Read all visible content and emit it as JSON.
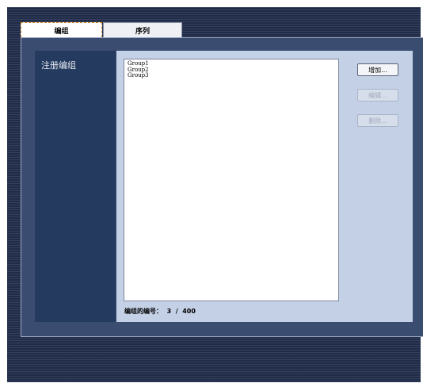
{
  "tabs": [
    {
      "label": "编组",
      "active": true
    },
    {
      "label": "序列",
      "active": false
    }
  ],
  "left_panel": {
    "title": "注册编组"
  },
  "group_list": {
    "items": [
      "Group1",
      "Group2",
      "Group3"
    ]
  },
  "count": {
    "label": "编组的编号：",
    "value": "3  /  400"
  },
  "buttons": {
    "add": {
      "label": "增加...",
      "enabled": true
    },
    "edit": {
      "label": "编辑...",
      "enabled": false
    },
    "delete": {
      "label": "删除...",
      "enabled": false
    }
  },
  "colors": {
    "background": "#1f2b48",
    "panel": "#3a4d70",
    "left_column": "#243a5e",
    "content_area": "#c3d0e6",
    "active_tab_border": "#d98a1a"
  }
}
